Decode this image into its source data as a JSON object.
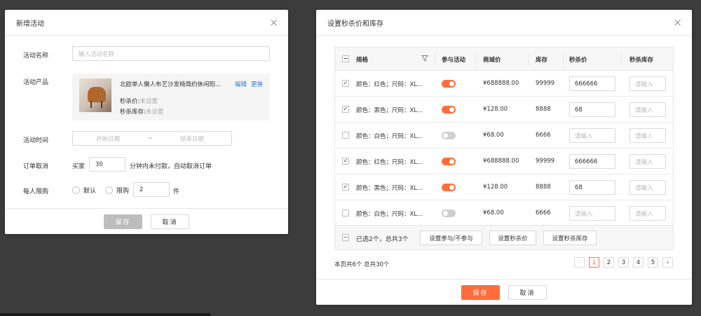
{
  "left_dialog": {
    "title": "新增活动",
    "close": "×",
    "name_label": "活动名称",
    "name_placeholder": "输入活动名称",
    "product_label": "活动产品",
    "product_title": "北欧单人懒人布艺沙发椅简约休闲阳...",
    "edit_link": "编辑",
    "replace_link": "更换",
    "seckill_price_label": "秒杀价:",
    "seckill_price_value": "未设置",
    "seckill_stock_label": "秒杀库存:",
    "seckill_stock_value": "未设置",
    "time_label": "活动时间",
    "start_placeholder": "开始日期",
    "range_sep": "~",
    "end_placeholder": "结束日期",
    "cancel_label": "订单取消",
    "buyer_text": "买家",
    "minutes_value": "30",
    "cancel_suffix": "分钟内未付款，自动取消订单",
    "limit_label": "每人限购",
    "opt_default": "默认",
    "opt_limit": "限购",
    "limit_value": "2",
    "limit_unit": "件",
    "save": "保存",
    "cancel": "取消"
  },
  "right_dialog": {
    "title": "设置秒杀价和库存",
    "close": "×",
    "headers": {
      "spec": "规格",
      "join": "参与活动",
      "mall_price": "商城价",
      "stock": "库存",
      "seckill_price": "秒杀价",
      "seckill_stock": "秒杀库存"
    },
    "rows": [
      {
        "checked": "✓",
        "spec": "颜色：红色；尺码：XL...",
        "join": "on",
        "price": "¥688888.00",
        "stock": "99999",
        "sk_price": "666666",
        "sk_price_ph": false,
        "sk_stock": "请输入"
      },
      {
        "checked": "✓",
        "spec": "颜色：黑色；尺码：XL...",
        "join": "on",
        "price": "¥128.00",
        "stock": "8888",
        "sk_price": "68",
        "sk_price_ph": false,
        "sk_stock": "请输入"
      },
      {
        "checked": "",
        "spec": "颜色：白色；尺码：XL...",
        "join": "off",
        "price": "¥68.00",
        "stock": "6666",
        "sk_price": "请输入",
        "sk_price_ph": true,
        "sk_stock": "请输入"
      },
      {
        "checked": "✓",
        "spec": "颜色：红色；尺码：XL...",
        "join": "on",
        "price": "¥688888.00",
        "stock": "99999",
        "sk_price": "666666",
        "sk_price_ph": false,
        "sk_stock": "请输入"
      },
      {
        "checked": "✓",
        "spec": "颜色：黑色；尺码：XL...",
        "join": "on",
        "price": "¥128.00",
        "stock": "8888",
        "sk_price": "68",
        "sk_price_ph": false,
        "sk_stock": "请输入"
      },
      {
        "checked": "",
        "spec": "颜色：白色；尺码：XL...",
        "join": "off",
        "price": "¥68.00",
        "stock": "6666",
        "sk_price": "请输入",
        "sk_price_ph": true,
        "sk_stock": "请输入"
      }
    ],
    "selected_text": "已选2个，总共3个",
    "btn_join": "设置参与/不参与",
    "btn_price": "设置秒杀价",
    "btn_stock": "设置秒杀库存",
    "page_info": "本页共6个  总共30个",
    "pages": [
      "1",
      "2",
      "3",
      "4",
      "5"
    ],
    "prev": "‹",
    "next": "›",
    "save": "保存",
    "cancel": "取消"
  },
  "colors": {
    "accent": "#ff6d3b",
    "link": "#2d7fd6"
  }
}
